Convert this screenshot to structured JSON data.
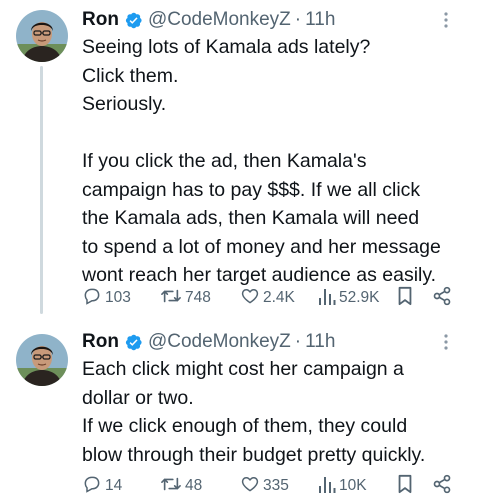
{
  "tweets": [
    {
      "author": {
        "name": "Ron",
        "handle": "@CodeMonkeyZ",
        "time": "11h"
      },
      "lines": [
        "Seeing lots of Kamala ads lately?",
        "Click them.",
        "Seriously.",
        "",
        "If you click the ad, then Kamala's",
        "campaign has to pay $$$. If we all click",
        "the Kamala ads, then Kamala will need",
        "to spend a lot of money and her message",
        "wont reach her target audience as easily."
      ],
      "stats": {
        "replies": "103",
        "reposts": "748",
        "likes": "2.4K",
        "views": "52.9K"
      }
    },
    {
      "author": {
        "name": "Ron",
        "handle": "@CodeMonkeyZ",
        "time": "11h"
      },
      "lines": [
        "Each click might cost her campaign a",
        "dollar or two.",
        "If we click enough of them, they could",
        "blow through their budget pretty quickly."
      ],
      "stats": {
        "replies": "14",
        "reposts": "48",
        "likes": "335",
        "views": "10K"
      }
    }
  ],
  "separator": "·",
  "colors": {
    "text": "#0f1419",
    "secondary": "#536471",
    "verified": "#1d9bf0",
    "thread_line": "#cfd9de"
  },
  "icons": [
    "verified-badge-icon",
    "more-icon",
    "reply-icon",
    "repost-icon",
    "like-icon",
    "views-icon",
    "bookmark-icon",
    "share-icon"
  ]
}
